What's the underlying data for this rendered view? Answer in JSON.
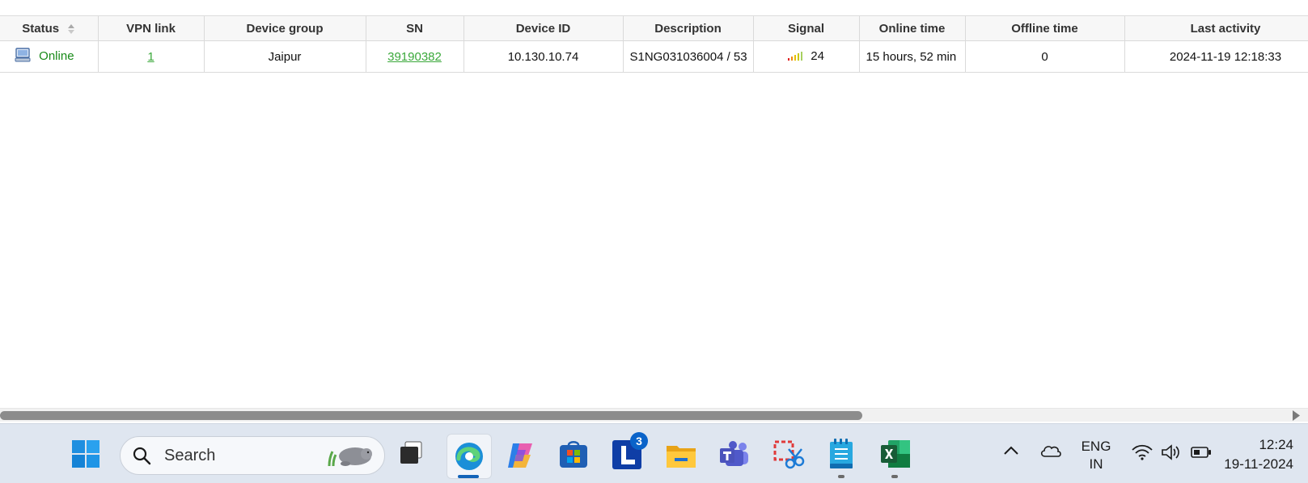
{
  "table": {
    "columns": [
      "Status",
      "VPN link",
      "Device group",
      "SN",
      "Device ID",
      "Description",
      "Signal",
      "Online time",
      "Offline time",
      "Last activity"
    ],
    "rows": [
      {
        "status": "Online",
        "vpn_link": "1",
        "device_group": "Jaipur",
        "sn": "39190382",
        "device_id": "10.130.10.74",
        "description": "S1NG031036004 / 53",
        "signal": "24",
        "online_time": "15 hours, 52 min",
        "offline_time": "0",
        "last_activity": "2024-11-19 12:18:33"
      }
    ]
  },
  "taskbar": {
    "search_label": "Search",
    "notification_badge": "3",
    "language_line1": "ENG",
    "language_line2": "IN",
    "time": "12:24",
    "date": "19-11-2024",
    "apps": [
      "windows-start-icon",
      "task-view-icon",
      "edge-browser-icon",
      "copilot-icon",
      "microsoft-store-icon",
      "l-app-icon",
      "file-explorer-icon",
      "teams-icon",
      "snipping-tool-icon",
      "notepad-icon",
      "excel-icon"
    ]
  },
  "colors": {
    "online_green": "#188a18",
    "link_green": "#3aa83a",
    "badge_blue": "#0a63c9",
    "taskbar_bg": "#dfe6f0"
  }
}
